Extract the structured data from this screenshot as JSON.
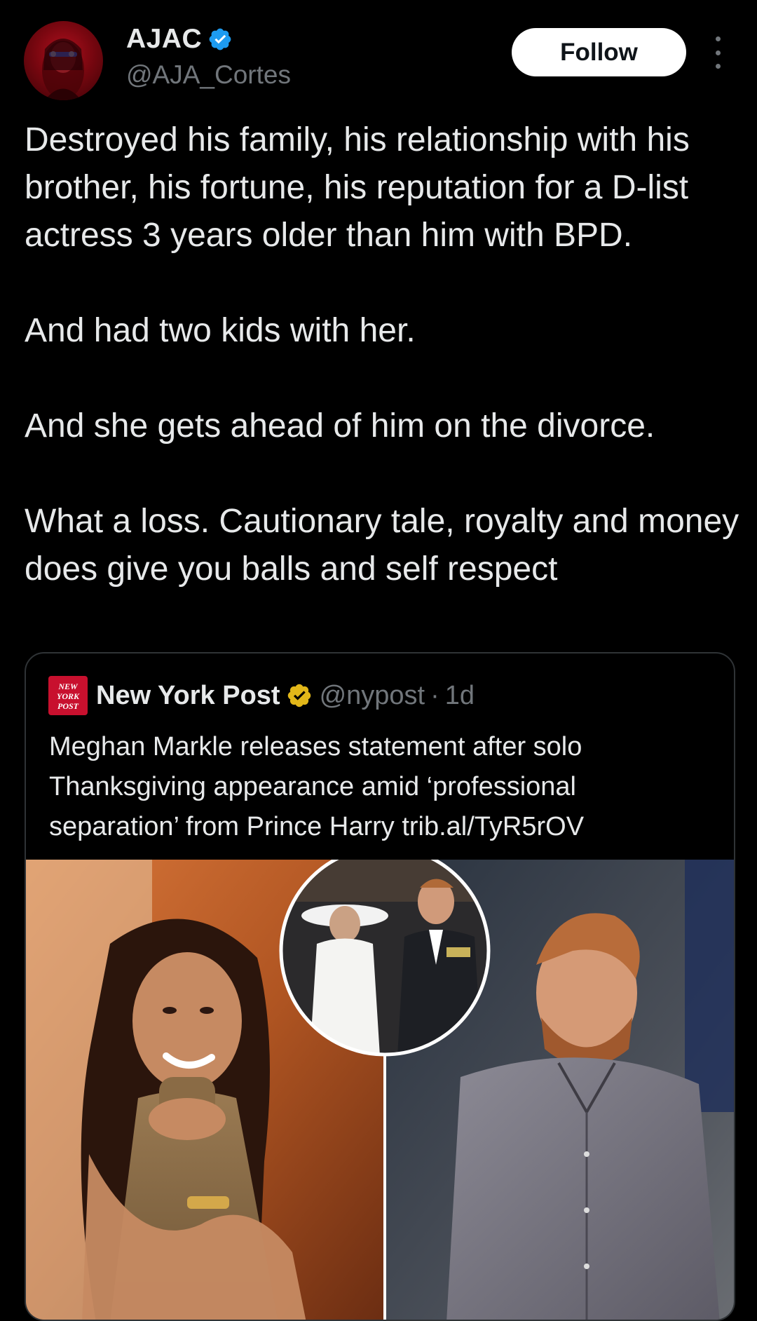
{
  "author": {
    "display_name": "AJAC",
    "handle": "@AJA_Cortes",
    "verified_badge_color": "#1d9bf0"
  },
  "actions": {
    "follow_label": "Follow",
    "more_icon": "more-vertical-icon"
  },
  "tweet": {
    "paragraphs": [
      "Destroyed his family, his relationship with his brother, his fortune, his reputation for a D-list actress 3 years older than him with BPD.",
      "And had two kids with her.",
      "And she gets ahead of him on the divorce.",
      "What a loss. Cautionary tale, royalty and money does give you balls and self respect"
    ]
  },
  "quote": {
    "source_name": "New York Post",
    "source_logo_text": "NEW YORK POST",
    "badge_color": "#e2b719",
    "handle": "@nypost",
    "separator": "·",
    "age": "1d",
    "lines": [
      "Meghan Markle releases statement after solo",
      "Thanksgiving appearance amid ‘professional",
      "separation’ from Prince Harry trib.al/TyR5rOV"
    ]
  },
  "colors": {
    "background": "#000000",
    "text": "#e7e9ea",
    "muted": "#71767b",
    "border": "#2f3336"
  }
}
